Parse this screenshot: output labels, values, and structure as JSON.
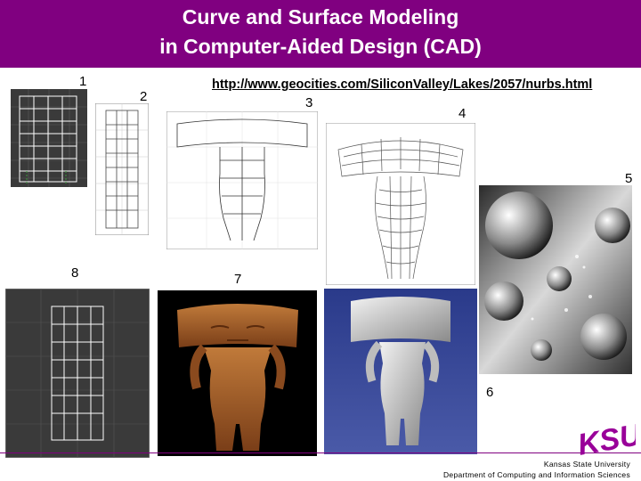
{
  "slide": {
    "title_line1": "Curve and Surface Modeling",
    "title_line2": "in Computer-Aided Design (CAD)",
    "url": "http://www.geocities.com/SiliconValley/Lakes/2057/nurbs.html",
    "labels": {
      "one": "1",
      "two": "2",
      "three": "3",
      "four": "4",
      "five": "5",
      "six": "6",
      "seven": "7",
      "eight": "8"
    },
    "footer": {
      "university": "Kansas State University",
      "department": "Department of Computing and Information Sciences"
    },
    "logo_text": "KSU",
    "colors": {
      "title_bar": "#800080",
      "logo": "#990099"
    }
  }
}
